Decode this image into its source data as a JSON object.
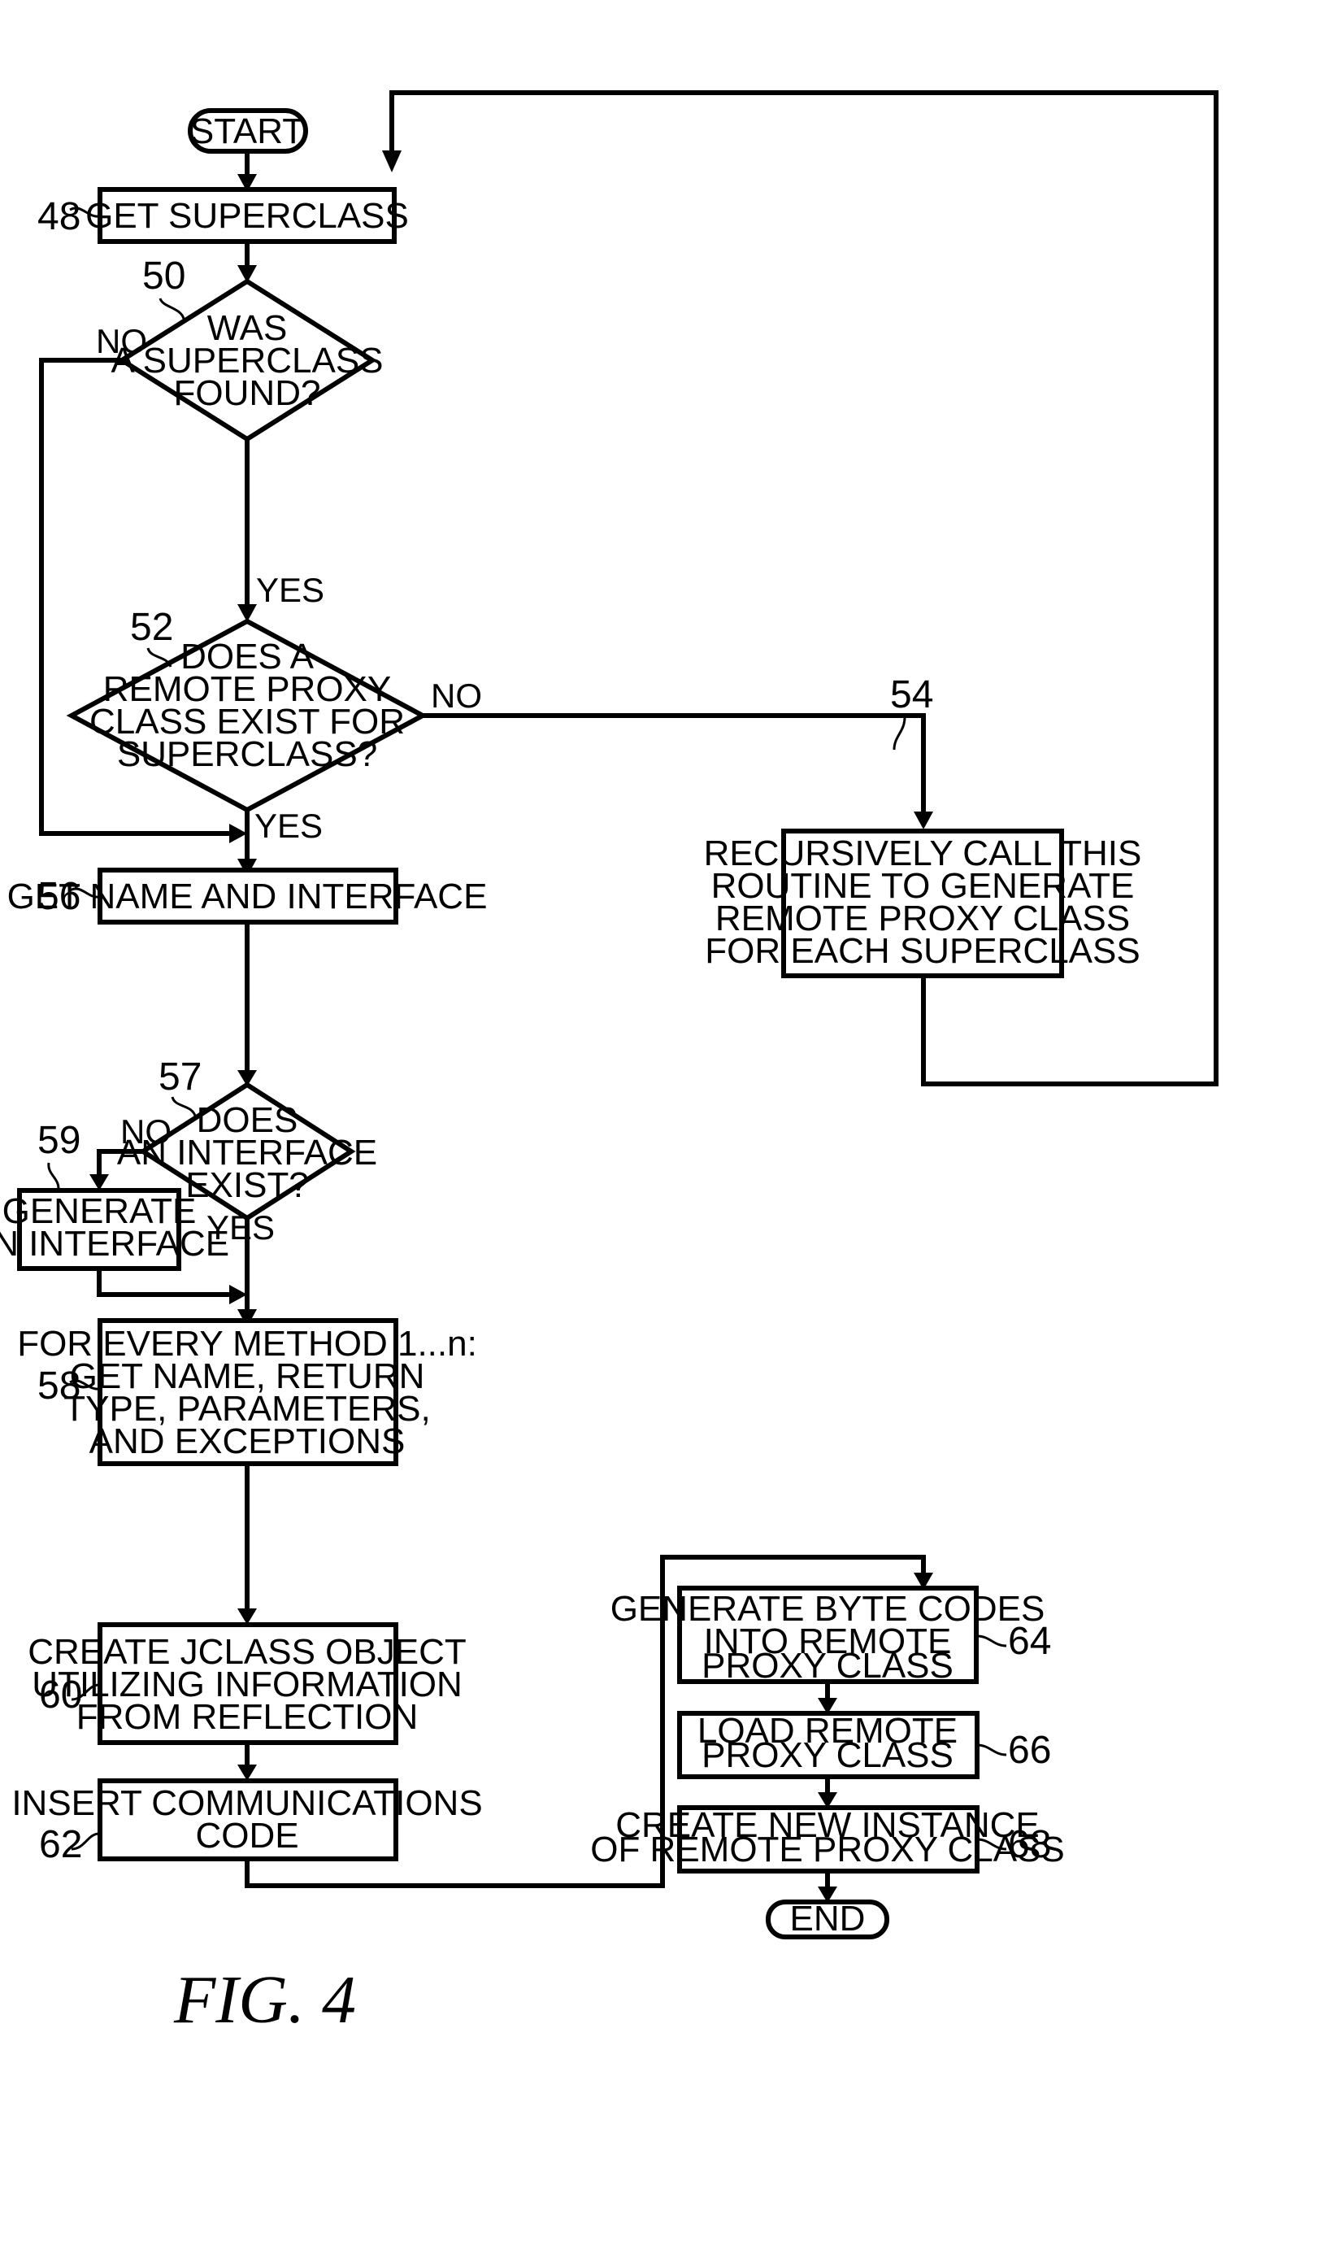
{
  "figure": {
    "caption": "FIG. 4"
  },
  "nodes": {
    "start": {
      "text": "START"
    },
    "n48": {
      "ref": "48",
      "lines": [
        "GET SUPERCLASS"
      ]
    },
    "n50": {
      "ref": "50",
      "lines": [
        "WAS",
        "A SUPERCLASS",
        "FOUND?"
      ]
    },
    "n52": {
      "ref": "52",
      "lines": [
        "DOES A",
        "REMOTE PROXY",
        "CLASS EXIST FOR",
        "SUPERCLASS?"
      ]
    },
    "n54": {
      "ref": "54",
      "lines": [
        "RECURSIVELY CALL THIS",
        "ROUTINE TO GENERATE",
        "REMOTE PROXY CLASS",
        "FOR EACH SUPERCLASS"
      ]
    },
    "n56": {
      "ref": "56",
      "lines": [
        "GET NAME AND INTERFACE"
      ]
    },
    "n57": {
      "ref": "57",
      "lines": [
        "DOES",
        "AN INTERFACE",
        "EXIST?"
      ]
    },
    "n59": {
      "ref": "59",
      "lines": [
        "GENERATE",
        "AN INTERFACE"
      ]
    },
    "n58": {
      "ref": "58",
      "lines": [
        "FOR EVERY METHOD 1...n:",
        "GET NAME, RETURN",
        "TYPE, PARAMETERS,",
        "AND EXCEPTIONS"
      ]
    },
    "n60": {
      "ref": "60",
      "lines": [
        "CREATE JCLASS OBJECT",
        "UTILIZING INFORMATION",
        "FROM REFLECTION"
      ]
    },
    "n62": {
      "ref": "62",
      "lines": [
        "INSERT COMMUNICATIONS",
        "CODE"
      ]
    },
    "n64": {
      "ref": "64",
      "lines": [
        "GENERATE BYTE CODES",
        "INTO REMOTE",
        "PROXY CLASS"
      ]
    },
    "n66": {
      "ref": "66",
      "lines": [
        "LOAD REMOTE",
        "PROXY CLASS"
      ]
    },
    "n68": {
      "ref": "68",
      "lines": [
        "CREATE NEW INSTANCE",
        "OF REMOTE PROXY CLASS"
      ]
    },
    "end": {
      "text": "END"
    }
  },
  "edge_labels": {
    "n50_no": "NO",
    "n50_yes": "YES",
    "n52_no": "NO",
    "n52_yes": "YES",
    "n57_no": "NO",
    "n57_yes": "YES"
  }
}
